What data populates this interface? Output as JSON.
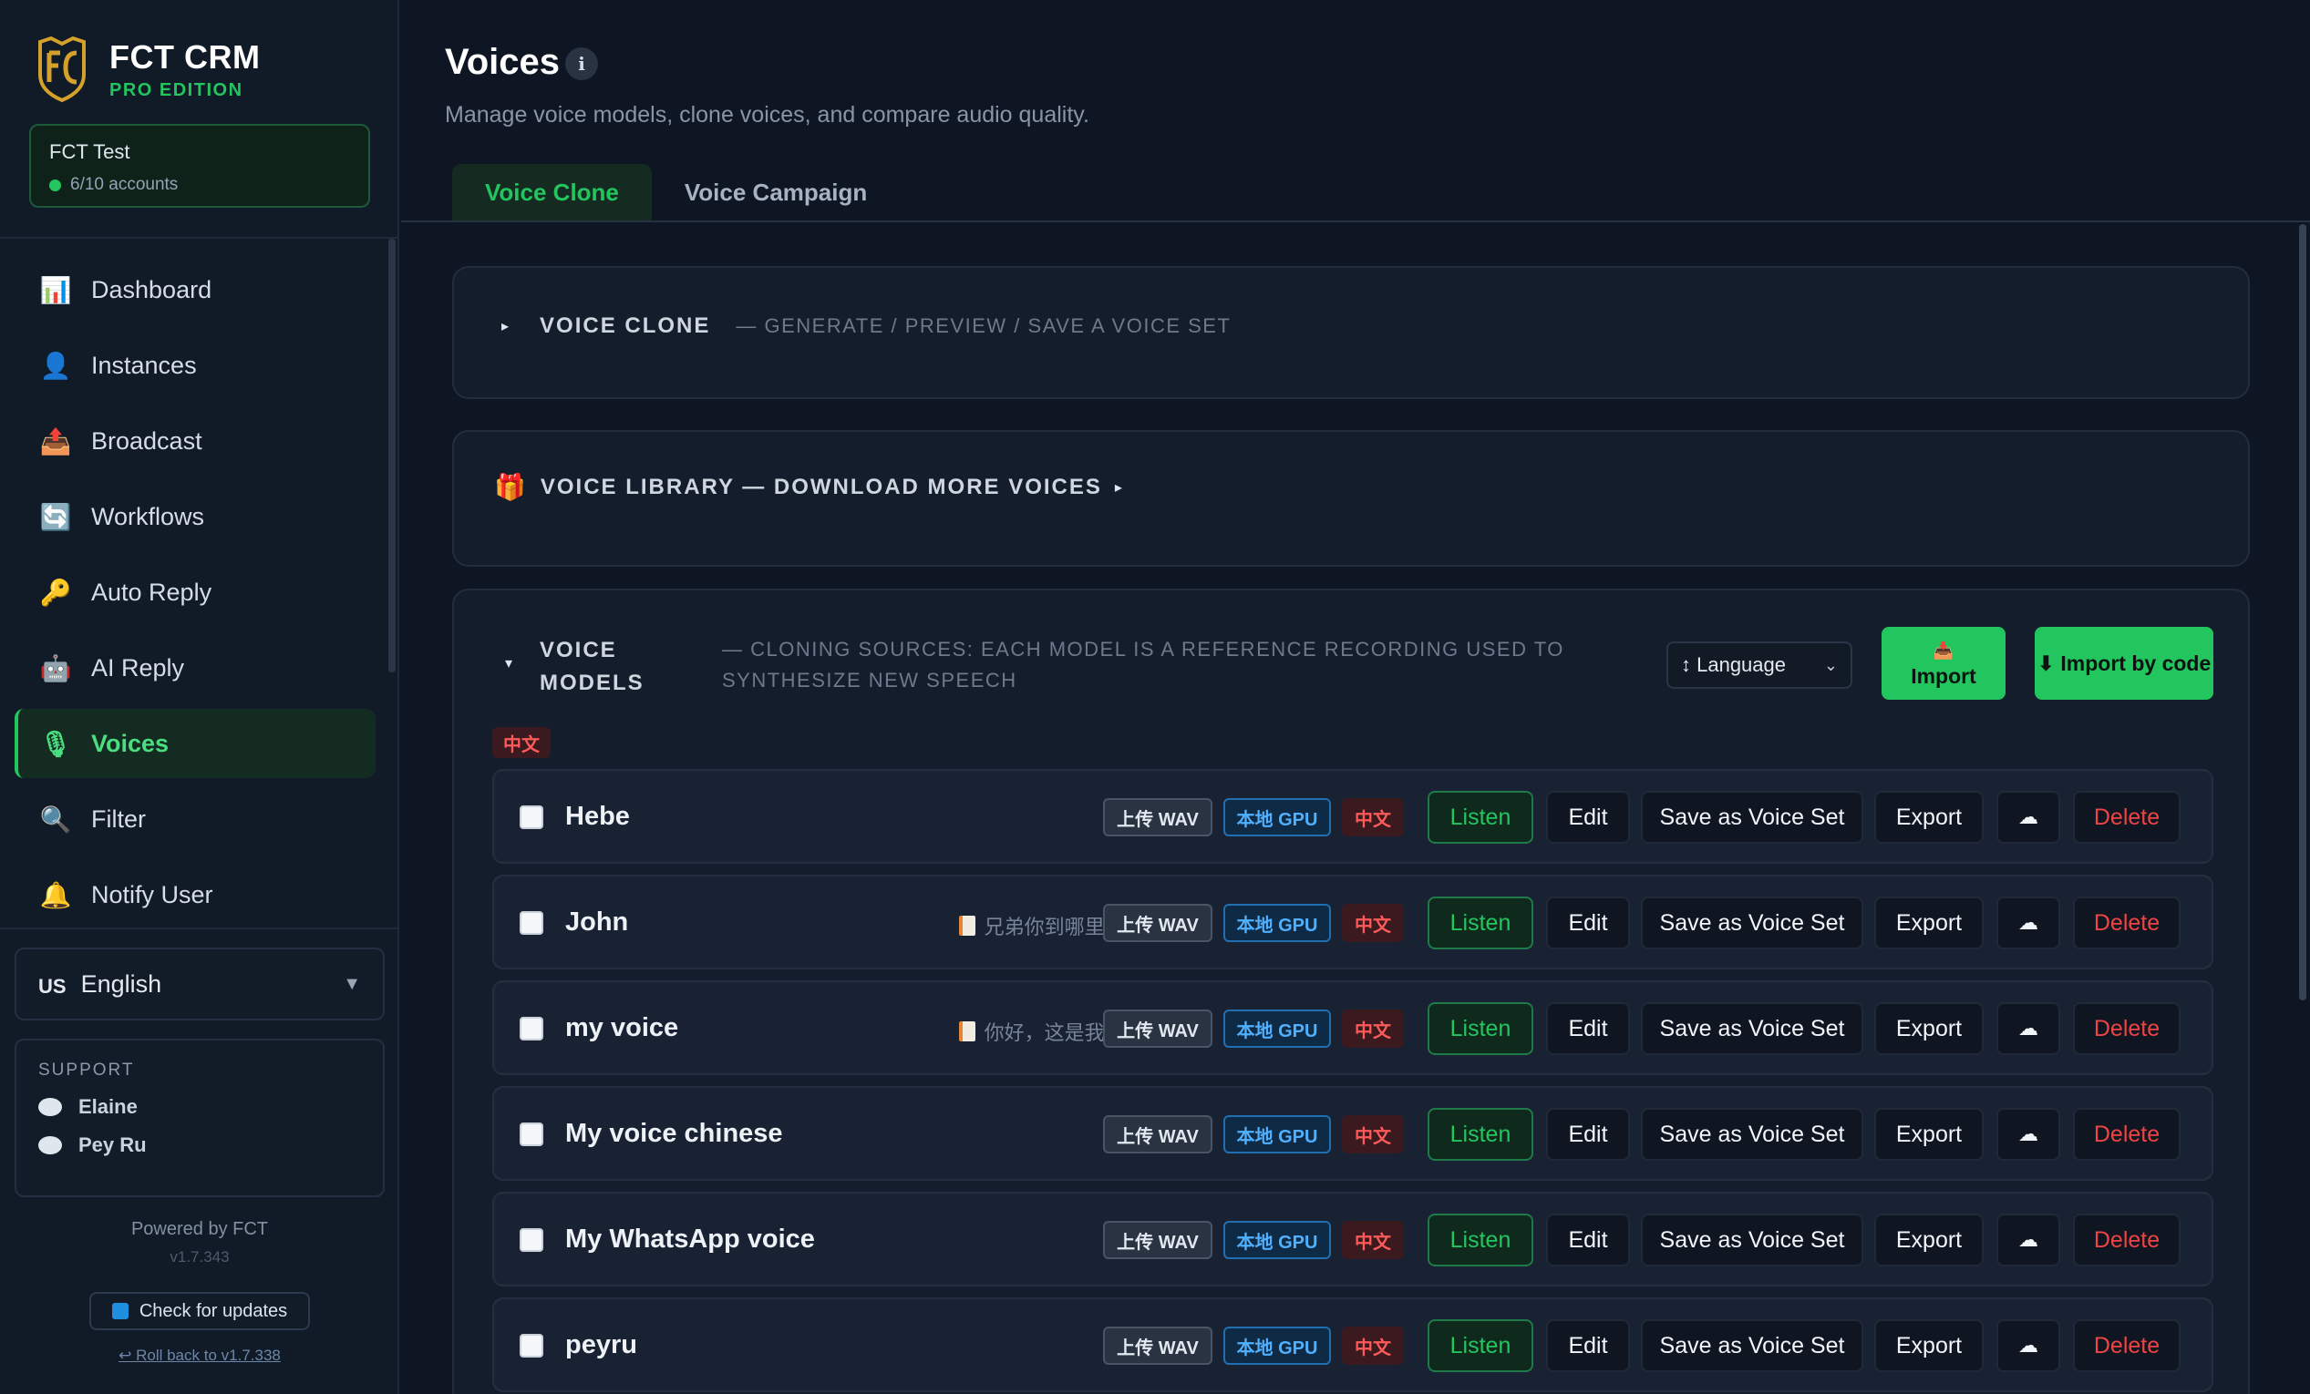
{
  "app": {
    "brand_title": "FCT CRM",
    "brand_sub": "PRO EDITION",
    "account_name": "FCT Test",
    "account_status": "6/10 accounts"
  },
  "sidebar": {
    "items": [
      {
        "label": "Dashboard",
        "icon": "chart-icon",
        "glyph": "📊"
      },
      {
        "label": "Instances",
        "icon": "person-icon",
        "glyph": "👤"
      },
      {
        "label": "Broadcast",
        "icon": "mailbox-icon",
        "glyph": "📤"
      },
      {
        "label": "Workflows",
        "icon": "sync-icon",
        "glyph": "🔄"
      },
      {
        "label": "Auto Reply",
        "icon": "key-icon",
        "glyph": "🔑"
      },
      {
        "label": "AI Reply",
        "icon": "robot-icon",
        "glyph": "🤖"
      },
      {
        "label": "Voices",
        "icon": "microphone-icon",
        "glyph": "🎙",
        "active": true
      },
      {
        "label": "Filter",
        "icon": "search-icon",
        "glyph": "🔍"
      },
      {
        "label": "Notify User",
        "icon": "bell-icon",
        "glyph": "🔔"
      }
    ],
    "language_flag": "US",
    "language": "English",
    "support_title": "SUPPORT",
    "support_contacts": [
      "Elaine",
      "Pey Ru"
    ],
    "powered_by": "Powered by FCT",
    "version": "v1.7.343",
    "check_updates": "Check for updates",
    "rollback": "↩ Roll back to v1.7.338"
  },
  "page": {
    "title": "Voices",
    "subtitle": "Manage voice models, clone voices, and compare audio quality.",
    "tabs": [
      "Voice Clone",
      "Voice Campaign"
    ]
  },
  "voice_clone": {
    "title": "VOICE CLONE",
    "note": "— GENERATE / PREVIEW / SAVE A VOICE SET"
  },
  "voice_library": {
    "title": "VOICE LIBRARY — DOWNLOAD MORE VOICES"
  },
  "voice_models": {
    "title": "VOICE MODELS",
    "note": "— CLONING SOURCES: EACH MODEL IS A REFERENCE RECORDING USED TO SYNTHESIZE NEW SPEECH",
    "sort_label": "↕ Language",
    "import_label": "Import",
    "import_code_label": "⬇ Import by code",
    "group_tag": "中文",
    "badges": {
      "wav": "上传 WAV",
      "gpu": "本地 GPU",
      "lang": "中文"
    },
    "actions": {
      "listen": "Listen",
      "edit": "Edit",
      "save": "Save as Voice Set",
      "export": "Export",
      "cloud": "☁",
      "delete": "Delete"
    },
    "rows": [
      {
        "name": "Hebe",
        "preview": ""
      },
      {
        "name": "John",
        "preview": "兄弟你到哪里..."
      },
      {
        "name": "my voice",
        "preview": "你好，这是我..."
      },
      {
        "name": "My voice chinese",
        "preview": ""
      },
      {
        "name": "My WhatsApp voice",
        "preview": ""
      },
      {
        "name": "peyru",
        "preview": ""
      }
    ]
  },
  "colors": {
    "accent": "#22c55e",
    "background": "#0f1623",
    "danger": "#ef4444",
    "info": "#4fb0ff"
  }
}
